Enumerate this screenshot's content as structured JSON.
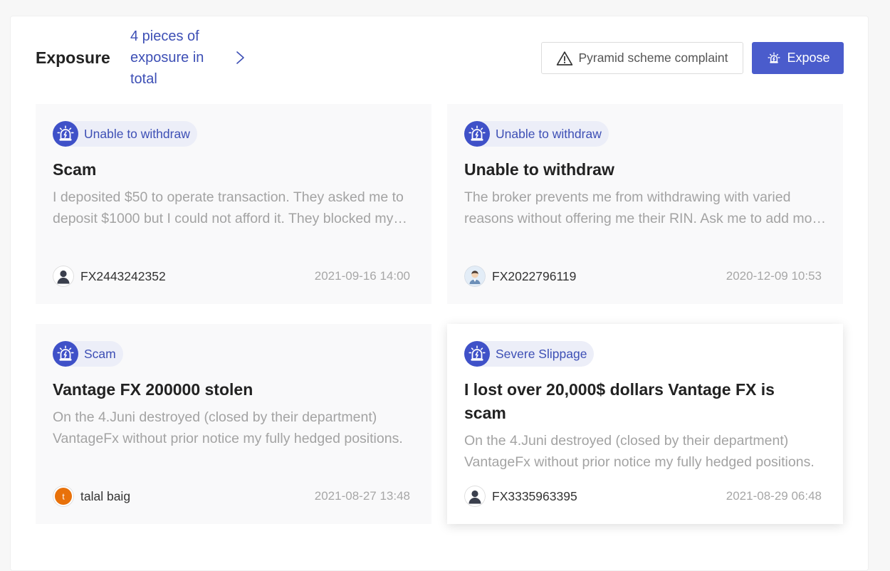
{
  "header": {
    "title": "Exposure",
    "count_text": "4 pieces of exposure in total",
    "complaint_label": "Pyramid scheme complaint",
    "expose_label": "Expose"
  },
  "colors": {
    "accent": "#4a5ccc",
    "tag_bg": "#eceef8",
    "tag_text": "#3d4fb5"
  },
  "cards": [
    {
      "tag": "Unable to withdraw",
      "title": "Scam",
      "body": "I deposited $50 to operate transaction. They asked me to deposit $1000 but I could not afford it. They blocked my account.",
      "user": "FX2443242352",
      "date": "2021-09-16 14:00",
      "avatar_icon": "default-user-avatar"
    },
    {
      "tag": "Unable to withdraw",
      "title": "Unable to withdraw",
      "body": "The broker prevents me from withdrawing with varied reasons without offering me their RIN. Ask me to add more deposits.",
      "user": "FX2022796119",
      "date": "2020-12-09 10:53",
      "avatar_icon": "person-avatar"
    },
    {
      "tag": "Scam",
      "title": "Vantage FX 200000 stolen",
      "body": "On the 4.Juni destroyed (closed by their department) VantageFx without prior notice my fully hedged positions.",
      "user": "talal baig",
      "date": "2021-08-27 13:48",
      "avatar_icon": "letter-avatar",
      "avatar_letter": "t"
    },
    {
      "tag": "Severe Slippage",
      "title": "I lost over 20,000$ dollars Vantage FX is scam",
      "body": "On the 4.Juni destroyed (closed by their department) VantageFx without prior notice my fully hedged positions.",
      "user": "FX3335963395",
      "date": "2021-08-29 06:48",
      "avatar_icon": "default-user-avatar"
    }
  ]
}
